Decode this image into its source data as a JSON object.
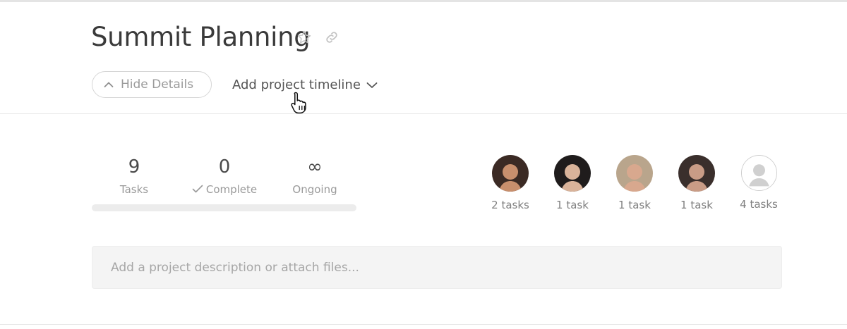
{
  "project": {
    "title": "Summit Planning"
  },
  "icons": {
    "star": "star-outline-icon",
    "link": "link-icon",
    "chevron_up": "chevron-up-icon",
    "chevron_down": "chevron-down-icon",
    "pointer": "hand-pointer-icon",
    "check": "check-icon",
    "user_placeholder": "user-placeholder-icon"
  },
  "actions": {
    "hide_details": "Hide Details",
    "add_timeline": "Add project timeline"
  },
  "stats": {
    "tasks": {
      "value": "9",
      "label": "Tasks"
    },
    "complete": {
      "value": "0",
      "label": "Complete"
    },
    "ongoing": {
      "value": "∞",
      "label": "Ongoing"
    },
    "progress_fraction": 0
  },
  "members": [
    {
      "tasks": "2 tasks",
      "colors": {
        "bg": "#3b2a24",
        "face": "#c88f6d"
      }
    },
    {
      "tasks": "1 task",
      "colors": {
        "bg": "#1f1c1c",
        "face": "#d9b39a"
      }
    },
    {
      "tasks": "1 task",
      "colors": {
        "bg": "#b9a58c",
        "face": "#d8a88e"
      }
    },
    {
      "tasks": "1 task",
      "colors": {
        "bg": "#3a2f2c",
        "face": "#c99c86"
      }
    },
    {
      "tasks": "4 tasks",
      "colors": {
        "bg": "#ffffff",
        "face": "#d0d0d0"
      }
    }
  ],
  "description": {
    "placeholder": "Add a project description or attach files..."
  },
  "colors": {
    "title": "#3a3a3a",
    "muted": "#9a9a9a",
    "progress_track": "#ececec",
    "desc_bg": "#f4f4f4"
  }
}
